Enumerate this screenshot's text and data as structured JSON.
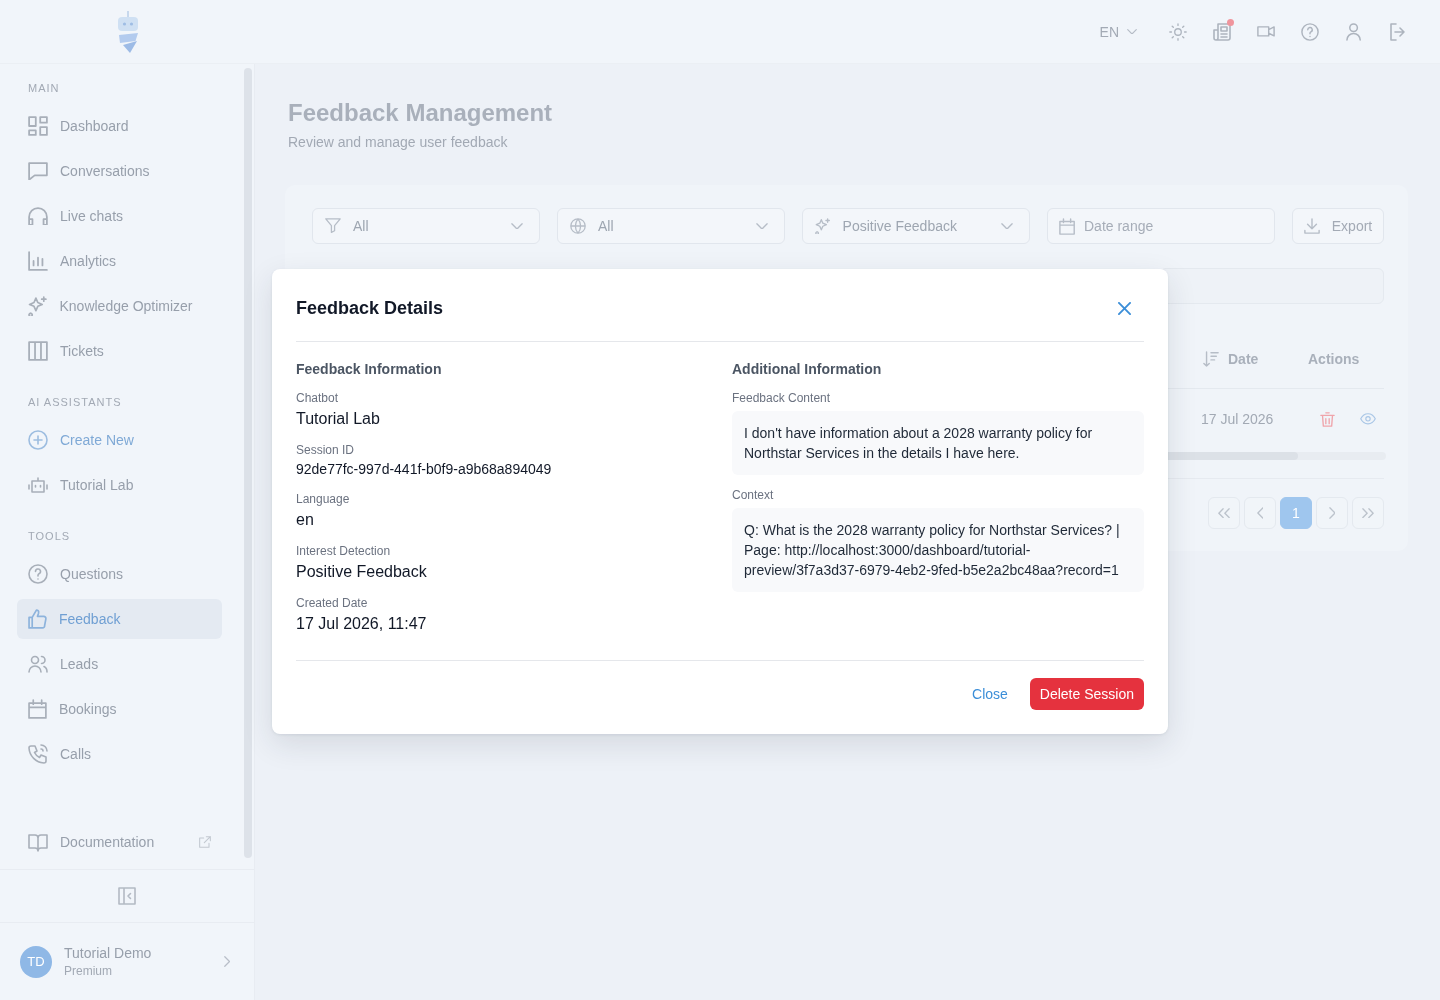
{
  "header": {
    "language": "EN",
    "notifications_unread": true
  },
  "sidebar": {
    "sections": [
      {
        "title": "MAIN",
        "items": [
          {
            "label": "Dashboard",
            "kind": "nav",
            "selected": false
          },
          {
            "label": "Conversations",
            "kind": "nav",
            "selected": false
          },
          {
            "label": "Live chats",
            "kind": "nav",
            "selected": false
          },
          {
            "label": "Analytics",
            "kind": "nav",
            "selected": false
          },
          {
            "label": "Knowledge Optimizer",
            "kind": "nav",
            "selected": false
          },
          {
            "label": "Tickets",
            "kind": "nav",
            "selected": false
          }
        ]
      },
      {
        "title": "AI ASSISTANTS",
        "items": [
          {
            "label": "Create New",
            "kind": "action",
            "selected": false
          },
          {
            "label": "Tutorial Lab",
            "kind": "nav",
            "selected": false
          }
        ]
      },
      {
        "title": "TOOLS",
        "items": [
          {
            "label": "Questions",
            "kind": "nav",
            "selected": false
          },
          {
            "label": "Feedback",
            "kind": "nav",
            "selected": true
          },
          {
            "label": "Leads",
            "kind": "nav",
            "selected": false
          },
          {
            "label": "Bookings",
            "kind": "nav",
            "selected": false
          },
          {
            "label": "Calls",
            "kind": "nav",
            "selected": false
          }
        ]
      }
    ],
    "documentation": {
      "label": "Documentation"
    },
    "user": {
      "initials": "TD",
      "name": "Tutorial Demo",
      "plan": "Premium"
    }
  },
  "page": {
    "title": "Feedback Management",
    "subtitle": "Review and manage user feedback"
  },
  "filters": [
    {
      "kind": "select",
      "value": "All"
    },
    {
      "kind": "select",
      "value": "All"
    },
    {
      "kind": "select",
      "value": "Positive Feedback"
    },
    {
      "kind": "date",
      "placeholder": "Date range"
    }
  ],
  "export_button": {
    "label": "Export"
  },
  "table": {
    "columns": [
      {
        "label": "Date",
        "sorted": true
      },
      {
        "label": "Actions",
        "sorted": false
      }
    ],
    "rows": [
      {
        "cells": [
          "17 Jul 2026"
        ]
      }
    ]
  },
  "pagination": {
    "pages": [
      {
        "label": "1",
        "selected": true
      }
    ]
  },
  "modal": {
    "title": "Feedback Details",
    "sections": [
      {
        "title": "Feedback Information",
        "fields": [
          {
            "label": "Chatbot",
            "value": "Tutorial Lab",
            "kind": "text"
          },
          {
            "label": "Session ID",
            "value": "92de77fc-997d-441f-b0f9-a9b68a894049",
            "kind": "id"
          },
          {
            "label": "Language",
            "value": "en",
            "kind": "text"
          },
          {
            "label": "Interest Detection",
            "value": "Positive Feedback",
            "kind": "text"
          },
          {
            "label": "Created Date",
            "value": "17 Jul 2026, 11:47",
            "kind": "text"
          }
        ]
      },
      {
        "title": "Additional Information",
        "fields": [
          {
            "label": "Feedback Content",
            "value": "I don't have information about a 2028 warranty policy for Northstar Services in the details I have here.",
            "kind": "block"
          },
          {
            "label": "Context",
            "value": "Q: What is the 2028 warranty policy for Northstar Services? | Page: http://localhost:3000/dashboard/tutorial-preview/3f7a3d37-6979-4eb2-9fed-b5e2a2bc48aa?record=1",
            "kind": "block"
          }
        ]
      }
    ],
    "buttons": [
      {
        "label": "Close",
        "kind": "link"
      },
      {
        "label": "Delete Session",
        "kind": "danger"
      }
    ]
  }
}
